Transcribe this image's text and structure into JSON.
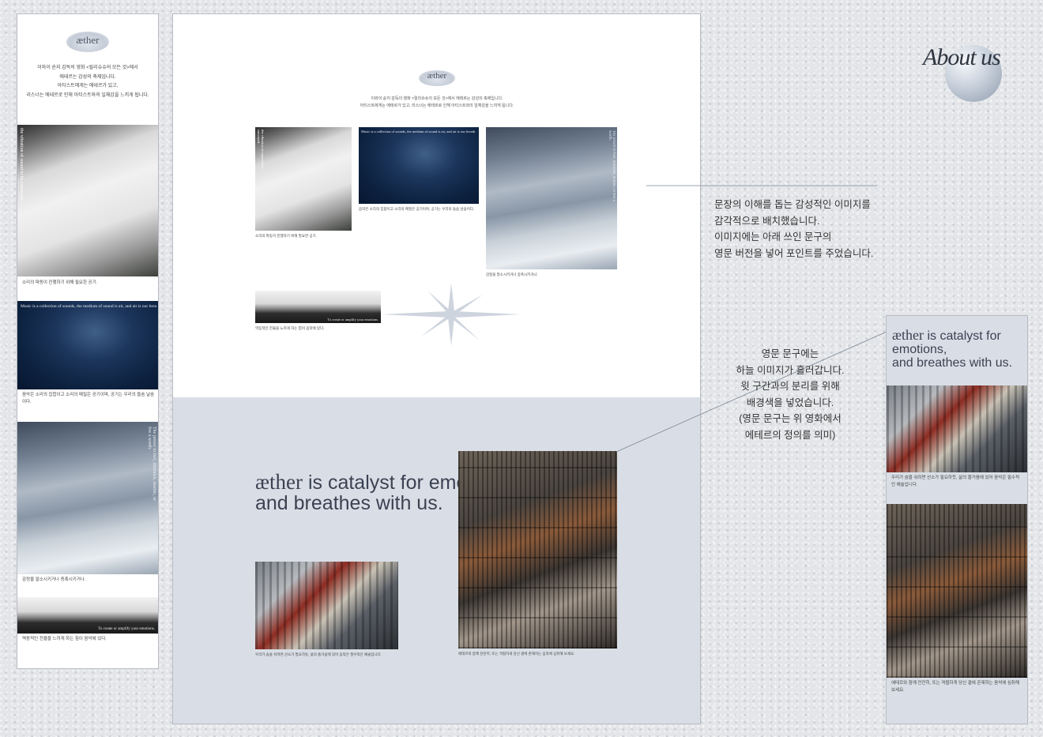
{
  "brand": "æther",
  "about": {
    "title": "About us"
  },
  "intro_text": [
    "이와이 슌지 감독의 영화 <릴리슈슈의 모든 것>에서",
    "에테르는 감성의 축제입니다.",
    "아티스트에게는 에테르가 있고,",
    "리스너는 에테르로 인해 아티스트와의 일체감을 느끼게 됩니다."
  ],
  "intro_text_wide": [
    "이와이 슌지 감독의 영화 <릴리슈슈의 모든 것>에서 에테르는 감성의 축제입니다.",
    "아티스트에게는 에테르가 있고, 리스너는 에테르로 인해 아티스트와의 일체감을 느끼게 됩니다."
  ],
  "photos": {
    "fog": {
      "overlay": "the vibration of sound to be conveyed.",
      "caption": "소리의 파동이 진행하기 위해 필요한 공기."
    },
    "hands": {
      "overlay": "Music is a collection of sounds, the medium of sound is air, and air is our breath.",
      "caption": "음악은 소리의 집합이고 소리의 매질은 공기이며, 공기는 우리의 들숨 날숨이다."
    },
    "sky": {
      "overlay": "The power to feel, diminish, double, or fire a worth.",
      "caption": "감정을 말소시키거나 증폭시키거나."
    },
    "turntable": {
      "overlay": "To create or amplify your emotions.",
      "caption": "역동적인 전율을 느끼게 하는 힘이 음악에 있다."
    },
    "records": {
      "caption": "우리가 숨을 쉬려면 산소가 필요하듯, 삶의 즐거움에 있어 음악은 필수적인 예술입니다."
    },
    "amps": {
      "caption": "에테르와 함께 잔잔히, 또는 격렬하게 당신 곁에 존재하는 음악에 심취해 보세요."
    }
  },
  "headline": {
    "line1_rest": " is catalyst for emotions,",
    "line2": "and breathes with us."
  },
  "headline_mobile": {
    "line1_rest": " is catalyst for",
    "line2": "emotions,",
    "line3": "and breathes with us."
  },
  "annotation1": [
    "문장의 이해를 돕는 감성적인 이미지를",
    "감각적으로 배치했습니다.",
    "이미지에는 아래 쓰인 문구의",
    "영문 버전을 넣어 포인트를 주었습니다."
  ],
  "annotation2": [
    "영문 문구에는",
    "하늘 이미지가 흘러갑니다.",
    "윗 구간과의 분리를 위해",
    "배경색을 넣었습니다.",
    "(영문 문구는 위 영화에서",
    "에테르의 정의를 의미)"
  ],
  "colors": {
    "accent_bg": "#d9dee6",
    "navy": "#0d2240",
    "text": "#333333"
  }
}
